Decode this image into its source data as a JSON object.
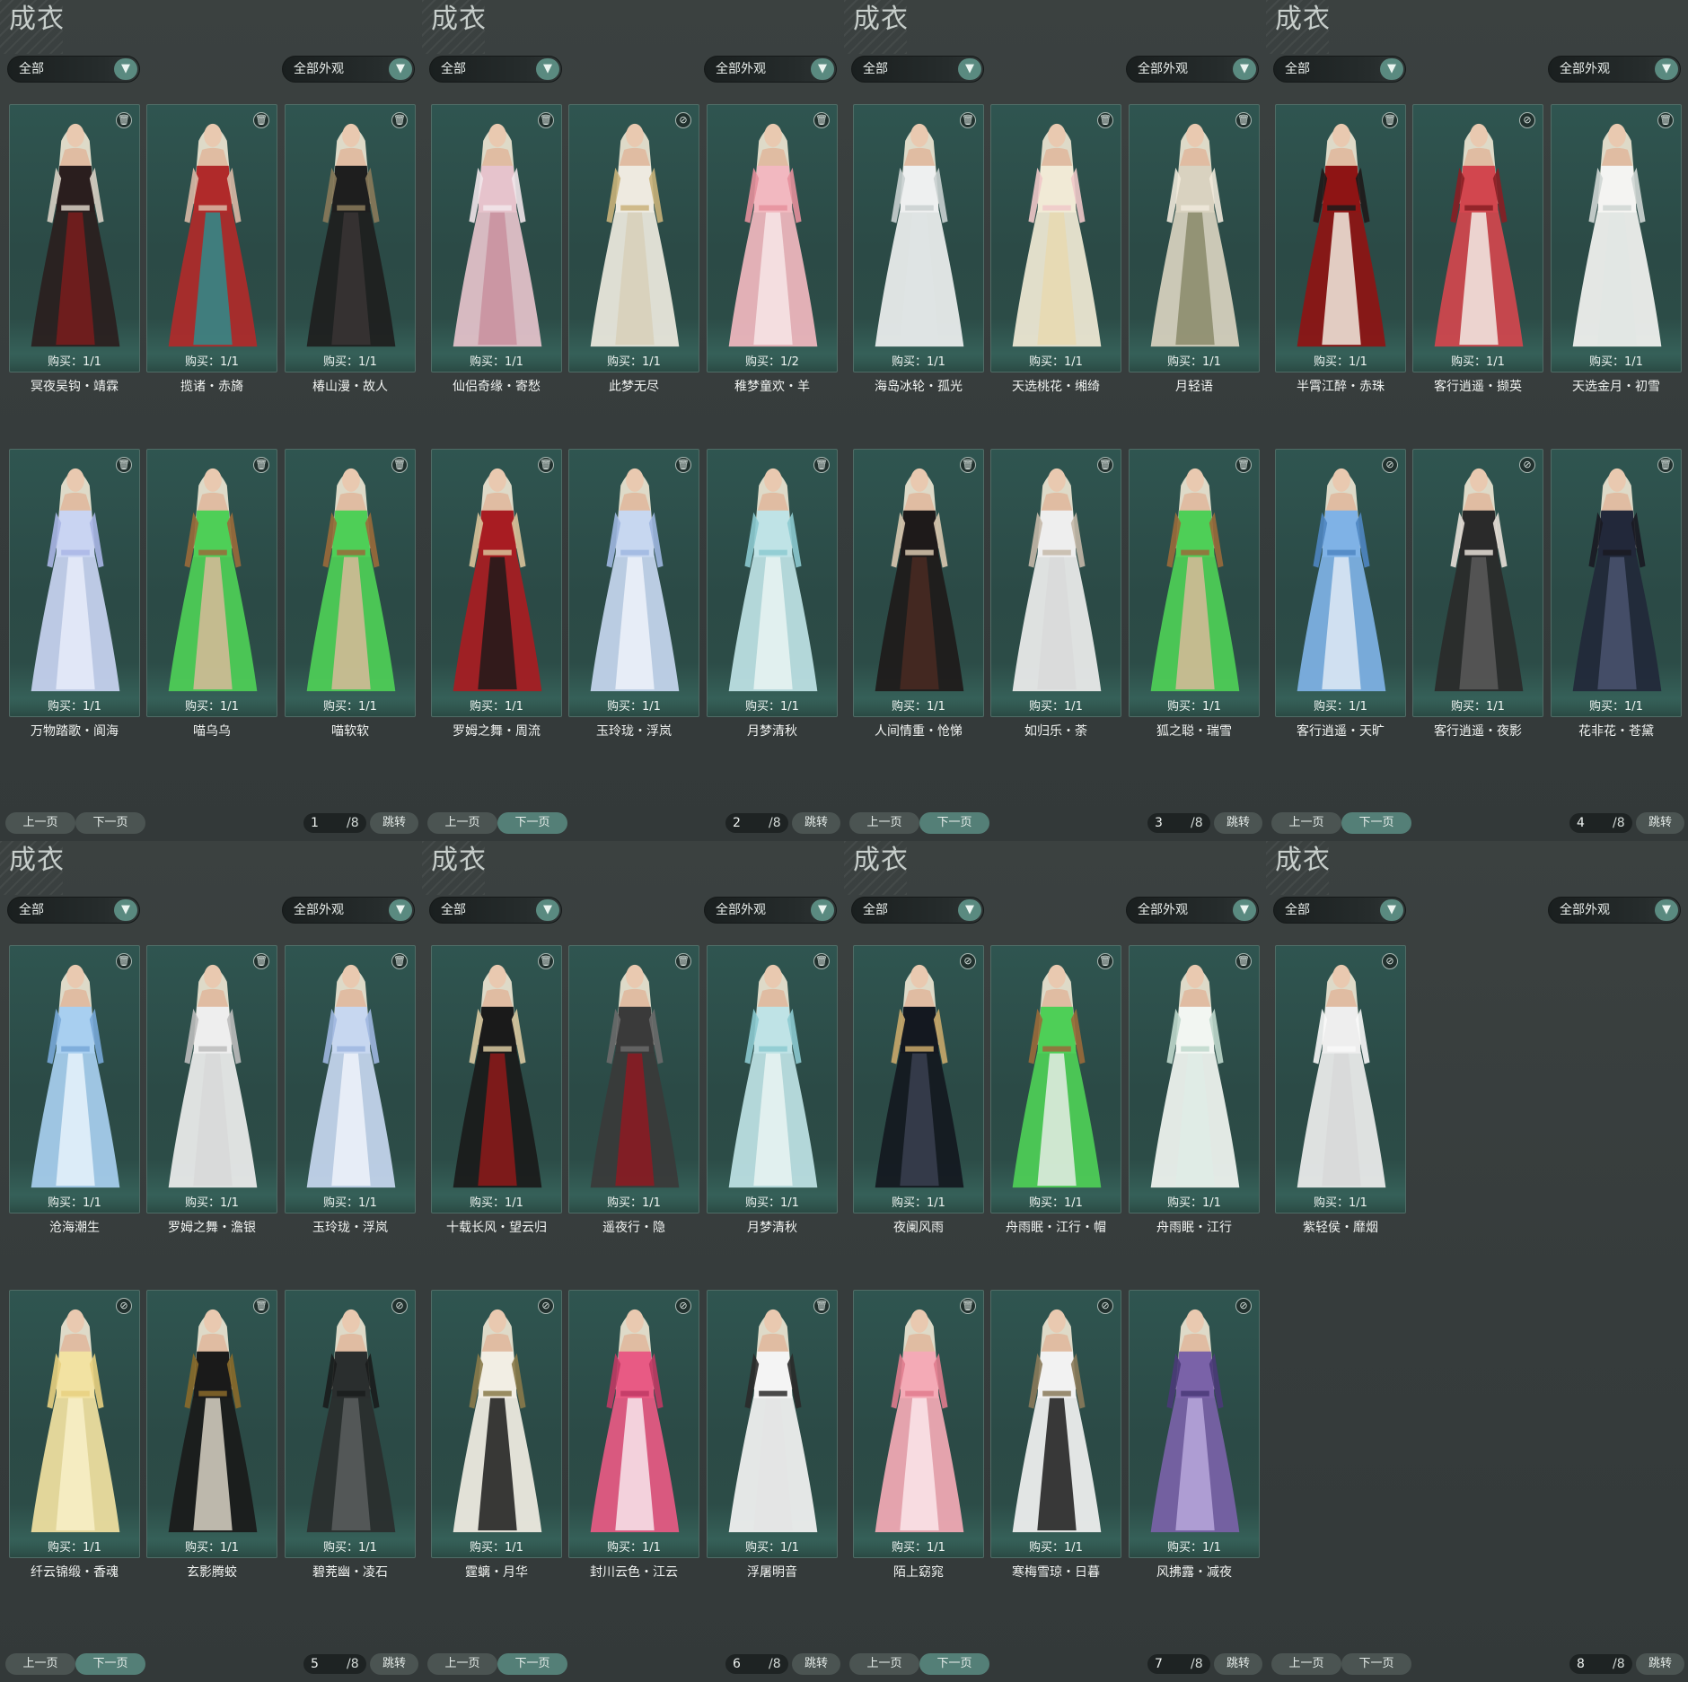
{
  "pages": [
    {
      "title": "成衣",
      "filter_label": "全部",
      "look_label": "全部外观",
      "pager": {
        "prev": "上一页",
        "next": "下一页",
        "current": "1",
        "total": "/8",
        "jump": "跳转",
        "next_enabled": false
      },
      "items": [
        {
          "name": "冥夜吴钩・靖霖",
          "buy": "购买：1/1",
          "icon": "trash-icon",
          "colors": [
            "#2a1e1e",
            "#7a1c1c",
            "#d8d0c4"
          ]
        },
        {
          "name": "揽诸・赤旖",
          "buy": "购买：1/1",
          "icon": "trash-icon",
          "colors": [
            "#b02a2a",
            "#2e8c8c",
            "#d9b9a6"
          ]
        },
        {
          "name": "椿山漫・故人",
          "buy": "购买：1/1",
          "icon": "trash-icon",
          "colors": [
            "#1e1e1e",
            "#3a3434",
            "#8a7a5a"
          ]
        },
        {
          "name": "万物踏歌・阆海",
          "buy": "购买：1/1",
          "icon": "trash-icon",
          "colors": [
            "#c9d4f2",
            "#e8ecfa",
            "#aab6e6"
          ]
        },
        {
          "name": "喵乌乌",
          "buy": "购买：1/1",
          "icon": "trash-icon",
          "colors": [
            "#4ecf57",
            "#d9b99a",
            "#9a6a3a"
          ]
        },
        {
          "name": "喵软软",
          "buy": "购买：1/1",
          "icon": "trash-icon",
          "colors": [
            "#4ecf57",
            "#d9b99a",
            "#9a6a3a"
          ]
        }
      ]
    },
    {
      "title": "成衣",
      "filter_label": "全部",
      "look_label": "全部外观",
      "pager": {
        "prev": "上一页",
        "next": "下一页",
        "current": "2",
        "total": "/8",
        "jump": "跳转",
        "next_enabled": true
      },
      "items": [
        {
          "name": "仙侣奇缘・寄愁",
          "buy": "购买：1/1",
          "icon": "trash-icon",
          "colors": [
            "#e6c3cc",
            "#c98f9e",
            "#f1e6ea"
          ]
        },
        {
          "name": "此梦无尽",
          "buy": "购买：1/1",
          "icon": "hidden-icon",
          "colors": [
            "#eeeae0",
            "#d8d0b8",
            "#c9b27a"
          ]
        },
        {
          "name": "稚梦童欢・羊",
          "buy": "购买：1/2",
          "icon": "trash-icon",
          "colors": [
            "#f2b8c0",
            "#f7e6e8",
            "#e6909c"
          ]
        },
        {
          "name": "罗姆之舞・周流",
          "buy": "购买：1/1",
          "icon": "trash-icon",
          "colors": [
            "#a81c22",
            "#1e1a1a",
            "#d9c39a"
          ]
        },
        {
          "name": "玉玲珑・浮岚",
          "buy": "购买：1/1",
          "icon": "trash-icon",
          "colors": [
            "#c7d7f0",
            "#eef2fa",
            "#9fb7e0"
          ]
        },
        {
          "name": "月梦清秋",
          "buy": "购买：1/1",
          "icon": "trash-icon",
          "colors": [
            "#bfe3e6",
            "#e9f5f2",
            "#8ccad0"
          ]
        }
      ]
    },
    {
      "title": "成衣",
      "filter_label": "全部",
      "look_label": "全部外观",
      "pager": {
        "prev": "上一页",
        "next": "下一页",
        "current": "3",
        "total": "/8",
        "jump": "跳转",
        "next_enabled": true
      },
      "items": [
        {
          "name": "海岛冰轮・孤光",
          "buy": "购买：1/1",
          "icon": "trash-icon",
          "colors": [
            "#eef0f0",
            "#dfe4e4",
            "#c9d0d0"
          ]
        },
        {
          "name": "天选桃花・缃绮",
          "buy": "购买：1/1",
          "icon": "trash-icon",
          "colors": [
            "#f1ead6",
            "#e8d9b0",
            "#f0c9c9"
          ]
        },
        {
          "name": "月轻语",
          "buy": "购买：1/1",
          "icon": "trash-icon",
          "colors": [
            "#d9d2c0",
            "#8a8a6a",
            "#efe9da"
          ]
        },
        {
          "name": "人间情重・怆悌",
          "buy": "购买：1/1",
          "icon": "trash-icon",
          "colors": [
            "#1e1a1a",
            "#4a2a22",
            "#d9c9b0"
          ]
        },
        {
          "name": "如归乐・荼",
          "buy": "购买：1/1",
          "icon": "trash-icon",
          "colors": [
            "#eeeeee",
            "#d9d9d9",
            "#c4b8a8"
          ]
        },
        {
          "name": "狐之聪・瑞雪",
          "buy": "购买：1/1",
          "icon": "trash-icon",
          "colors": [
            "#4ecf57",
            "#d9b99a",
            "#9a6a3a"
          ]
        }
      ]
    },
    {
      "title": "成衣",
      "filter_label": "全部",
      "look_label": "全部外观",
      "pager": {
        "prev": "上一页",
        "next": "下一页",
        "current": "4",
        "total": "/8",
        "jump": "跳转",
        "next_enabled": true
      },
      "items": [
        {
          "name": "半霄江醉・赤珠",
          "buy": "购买：1/1",
          "icon": "trash-icon",
          "colors": [
            "#8e1414",
            "#f2ece0",
            "#1e1a1a"
          ]
        },
        {
          "name": "客行逍遥・撷英",
          "buy": "购买：1/1",
          "icon": "hidden-icon",
          "colors": [
            "#d2464e",
            "#f2ece6",
            "#8a1e24"
          ]
        },
        {
          "name": "天选金月・初雪",
          "buy": "购买：1/1",
          "icon": "trash-icon",
          "colors": [
            "#f4f4f2",
            "#e2e6e4",
            "#cfd6d4"
          ]
        },
        {
          "name": "客行逍遥・天旷",
          "buy": "购买：1/1",
          "icon": "hidden-icon",
          "colors": [
            "#7fb2e6",
            "#dfeaf4",
            "#4f86c2"
          ]
        },
        {
          "name": "客行逍遥・夜影",
          "buy": "购买：1/1",
          "icon": "hidden-icon",
          "colors": [
            "#2a2a2a",
            "#5a5a5a",
            "#e8e0d8"
          ]
        },
        {
          "name": "花非花・苍黛",
          "buy": "购买：1/1",
          "icon": "trash-icon",
          "colors": [
            "#22283a",
            "#4a5470",
            "#1a1a22"
          ]
        }
      ]
    },
    {
      "title": "成衣",
      "filter_label": "全部",
      "look_label": "全部外观",
      "pager": {
        "prev": "上一页",
        "next": "下一页",
        "current": "5",
        "total": "/8",
        "jump": "跳转",
        "next_enabled": true
      },
      "items": [
        {
          "name": "沧海潮生",
          "buy": "购买：1/1",
          "icon": "trash-icon",
          "colors": [
            "#a8cff0",
            "#e6f2fb",
            "#78a8d8"
          ]
        },
        {
          "name": "罗姆之舞・澹银",
          "buy": "购买：1/1",
          "icon": "trash-icon",
          "colors": [
            "#eeeeee",
            "#d8d8d8",
            "#bcbcbc"
          ]
        },
        {
          "name": "玉玲珑・浮岚",
          "buy": "购买：1/1",
          "icon": "trash-icon",
          "colors": [
            "#c7d7f0",
            "#eef2fa",
            "#9fb7e0"
          ]
        },
        {
          "name": "纤云锦缎・香魂",
          "buy": "购买：1/1",
          "icon": "hidden-icon",
          "colors": [
            "#f2e2a2",
            "#f8f0c8",
            "#e8d080"
          ]
        },
        {
          "name": "玄影腾蛟",
          "buy": "购买：1/1",
          "icon": "trash-icon",
          "colors": [
            "#1a1a1a",
            "#d9d3c6",
            "#8a6a2a"
          ]
        },
        {
          "name": "碧茺幽・凌石",
          "buy": "购买：1/1",
          "icon": "hidden-icon",
          "colors": [
            "#2a2e2e",
            "#5a5e5e",
            "#1a1c1c"
          ]
        }
      ]
    },
    {
      "title": "成衣",
      "filter_label": "全部",
      "look_label": "全部外观",
      "pager": {
        "prev": "上一页",
        "next": "下一页",
        "current": "6",
        "total": "/8",
        "jump": "跳转",
        "next_enabled": true
      },
      "items": [
        {
          "name": "十载长风・望云归",
          "buy": "购买：1/1",
          "icon": "trash-icon",
          "colors": [
            "#1a1a1a",
            "#8e1a1a",
            "#d9c9a0"
          ]
        },
        {
          "name": "遥夜行・隐",
          "buy": "购买：1/1",
          "icon": "trash-icon",
          "colors": [
            "#3a3a3a",
            "#8e1a22",
            "#6a6a6a"
          ]
        },
        {
          "name": "月梦清秋",
          "buy": "购买：1/1",
          "icon": "trash-icon",
          "colors": [
            "#bfe3e6",
            "#e9f5f2",
            "#8ccad0"
          ]
        },
        {
          "name": "霆螭・月华",
          "buy": "购买：1/1",
          "icon": "hidden-icon",
          "colors": [
            "#f2eee4",
            "#1a1a1a",
            "#8a7a4a"
          ]
        },
        {
          "name": "封川云色・江云",
          "buy": "购买：1/1",
          "icon": "hidden-icon",
          "colors": [
            "#e85a84",
            "#f7e6ec",
            "#c03a64"
          ]
        },
        {
          "name": "浮屠明音",
          "buy": "购买：1/1",
          "icon": "trash-icon",
          "colors": [
            "#f4f4f4",
            "#e4e4e4",
            "#2a2a2a"
          ]
        }
      ]
    },
    {
      "title": "成衣",
      "filter_label": "全部",
      "look_label": "全部外观",
      "pager": {
        "prev": "上一页",
        "next": "下一页",
        "current": "7",
        "total": "/8",
        "jump": "跳转",
        "next_enabled": true
      },
      "items": [
        {
          "name": "夜阑风雨",
          "buy": "购买：1/1",
          "icon": "hidden-icon",
          "colors": [
            "#141820",
            "#3a4050",
            "#c9a86a"
          ]
        },
        {
          "name": "舟雨眠・江行・帽",
          "buy": "购买：1/1",
          "icon": "trash-icon",
          "colors": [
            "#4ecf57",
            "#e6ece6",
            "#9a6a3a"
          ]
        },
        {
          "name": "舟雨眠・江行",
          "buy": "购买：1/1",
          "icon": "trash-icon",
          "colors": [
            "#f2f6f2",
            "#dfece6",
            "#bfd8cc"
          ]
        },
        {
          "name": "陌上窈窕",
          "buy": "购买：1/1",
          "icon": "trash-icon",
          "colors": [
            "#f4aab6",
            "#fbe6ea",
            "#e07c8e"
          ]
        },
        {
          "name": "寒梅雪琼・日暮",
          "buy": "购买：1/1",
          "icon": "hidden-icon",
          "colors": [
            "#f2f2f2",
            "#1a1a1a",
            "#8a7a5a"
          ]
        },
        {
          "name": "风拂露・减夜",
          "buy": "购买：1/1",
          "icon": "hidden-icon",
          "colors": [
            "#7a62a8",
            "#b8a8dc",
            "#4a3a78"
          ]
        }
      ]
    },
    {
      "title": "成衣",
      "filter_label": "全部",
      "look_label": "全部外观",
      "pager": {
        "prev": "上一页",
        "next": "下一页",
        "current": "8",
        "total": "/8",
        "jump": "跳转",
        "next_enabled": false
      },
      "items": [
        {
          "name": "紫轻侯・靡烟",
          "buy": "购买：1/1",
          "icon": "hidden-icon",
          "colors": [
            "#eeeeee",
            "#d8d8d8",
            "#f8f8f8"
          ]
        }
      ]
    }
  ],
  "icon_glyphs": {
    "trash-icon": "🗑",
    "hidden-icon": "⊘"
  }
}
